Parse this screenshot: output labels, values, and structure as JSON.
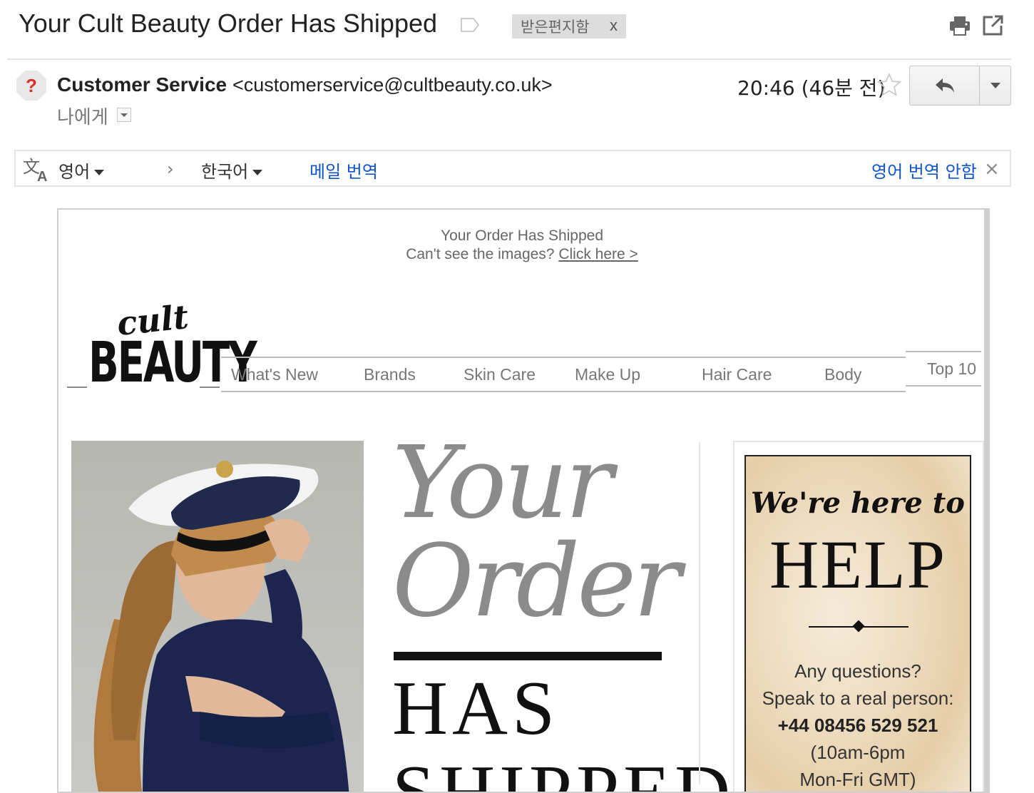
{
  "header": {
    "subject": "Your Cult Beauty Order Has Shipped",
    "inbox_label": "받은편지함",
    "inbox_label_remove": "x"
  },
  "sender": {
    "name": "Customer Service",
    "email": "<customerservice@cultbeauty.co.uk>",
    "to": "나에게",
    "time": "20:46 (46분 전)"
  },
  "translate_bar": {
    "source_lang": "영어",
    "arrow": "›",
    "target_lang": "한국어",
    "translate_link": "메일 번역",
    "no_translate_link": "영어 번역 안함",
    "close": "×"
  },
  "email": {
    "preheader_title": "Your Order Has Shipped",
    "preheader_text": "Can't see the images?",
    "preheader_link": "Click here >",
    "logo_top": "cult",
    "logo_bottom": "BEAUTY",
    "nav": [
      "What's New",
      "Brands",
      "Skin Care",
      "Make Up",
      "Hair Care",
      "Body",
      "Top 10"
    ],
    "hero": {
      "line1": "Your",
      "line2": "Order",
      "line3": "HAS",
      "line4": "SHIPPED"
    },
    "help": {
      "title1": "We're here to",
      "title2": "HELP",
      "q1": "Any questions?",
      "q2": "Speak to a real person:",
      "phone": "+44 08456 529 521",
      "hours": "(10am-6pm",
      "days": "Mon-Fri GMT)"
    }
  },
  "colors": {
    "link_blue": "#1155cc",
    "chip_bg": "#dddddd",
    "hero_gray": "#8b8b8b",
    "avatar_red": "#d93025"
  }
}
